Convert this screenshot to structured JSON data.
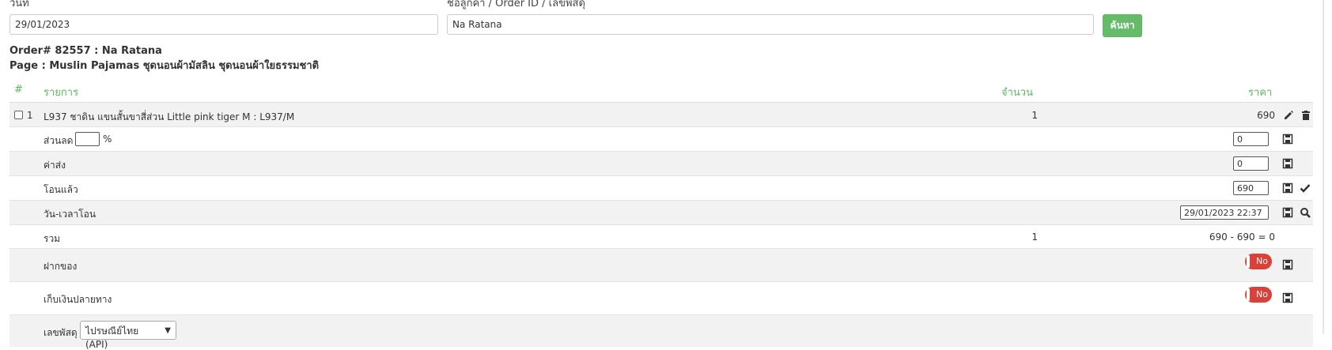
{
  "search": {
    "date_label": "วันที่",
    "date_value": "29/01/2023",
    "customer_label": "ชื่อลูกค้า / Order ID / เลขพัสดุ",
    "customer_value": "Na Ratana",
    "search_button": "ค้นหา"
  },
  "order": {
    "order_line": "Order# 82557 : Na Ratana",
    "page_line": "Page : Muslin Pajamas ชุดนอนผ้ามัสลิน ชุดนอนผ้าใยธรรมชาติ"
  },
  "table": {
    "headers": {
      "num": "#",
      "item": "รายการ",
      "qty": "จำนวน",
      "price": "ราคา"
    },
    "item": {
      "index": "1",
      "name": "L937 ชาดิน แขนสั้นขาสี่ส่วน Little pink tiger M : L937/M",
      "qty": "1",
      "price": "690"
    },
    "discount": {
      "label": "ส่วนลด",
      "percent_sign": "%",
      "percent_value": "",
      "value": "0"
    },
    "shipping": {
      "label": "ค่าส่ง",
      "value": "0"
    },
    "transferred": {
      "label": "โอนแล้ว",
      "value": "690"
    },
    "transfer_time": {
      "label": "วัน-เวลาโอน",
      "value": "29/01/2023 22:37"
    },
    "total": {
      "label": "รวม",
      "qty": "1",
      "summary": "690 - 690 = 0"
    },
    "deposit": {
      "label": "ฝากของ",
      "toggle": "No"
    },
    "cod": {
      "label": "เก็บเงินปลายทาง",
      "toggle": "No"
    },
    "tracking": {
      "label": "เลขพัสดุ",
      "carrier": "ไปรษณีย์ไทย (API)"
    }
  },
  "icons": {
    "edit": "pencil-icon",
    "delete": "trash-icon",
    "save": "floppy-disk-icon",
    "check": "checkmark-icon",
    "search": "magnifier-icon"
  },
  "colors": {
    "accent_green": "#5cb85c",
    "button_green": "#66bb6a",
    "toggle_red": "#d9413b",
    "row_alt": "#f2f2f2"
  }
}
